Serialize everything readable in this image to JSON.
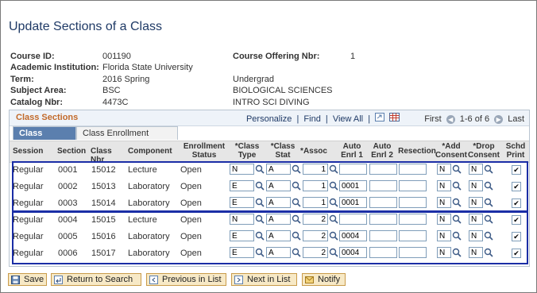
{
  "page_title": "Update Sections of a Class",
  "course_id": {
    "label": "Course ID:",
    "value": "001190"
  },
  "institution": {
    "label": "Academic Institution:",
    "value": "Florida State University"
  },
  "term": {
    "label": "Term:",
    "value": "2016 Spring",
    "career": "Undergrad"
  },
  "subject": {
    "label": "Subject Area:",
    "value": "BSC",
    "desc": "BIOLOGICAL SCIENCES"
  },
  "catalog": {
    "label": "Catalog Nbr:",
    "value": "4473C",
    "desc": "INTRO SCI DIVING"
  },
  "offering": {
    "label": "Course Offering Nbr:",
    "value": "1"
  },
  "grid": {
    "title": "Class Sections",
    "personalize": "Personalize",
    "sep1": "|",
    "find": "Find",
    "sep2": "|",
    "view_all": "View All",
    "sep3": "|",
    "first": "First",
    "range": "1-6 of 6",
    "last": "Last"
  },
  "tabs": [
    {
      "label": "Class Status",
      "active": true
    },
    {
      "label": "Class Enrollment Limits",
      "active": false
    }
  ],
  "headers": {
    "session": "Session",
    "section": "Section",
    "class_nbr": "Class Nbr",
    "component": "Component",
    "enroll_status_1": "Enrollment",
    "enroll_status_2": "Status",
    "class_type_1": "*Class",
    "class_type_2": "Type",
    "class_stat_1": "*Class",
    "class_stat_2": "Stat",
    "assoc": "*Assoc",
    "auto1_1": "Auto",
    "auto1_2": "Enrl 1",
    "auto2_1": "Auto",
    "auto2_2": "Enrl 2",
    "resection": "Resection",
    "add_1": "*Add",
    "add_2": "Consent",
    "drop_1": "*Drop",
    "drop_2": "Consent",
    "schd_1": "Schd",
    "schd_2": "Print"
  },
  "rows": [
    {
      "session": "Regular",
      "section": "0001",
      "class_nbr": "15012",
      "component": "Lecture",
      "status": "Open",
      "class_type": "N",
      "class_stat": "A",
      "assoc": "1",
      "auto1": "",
      "auto2": "",
      "resection": "",
      "add": "N",
      "drop": "N",
      "schd": "✔"
    },
    {
      "session": "Regular",
      "section": "0002",
      "class_nbr": "15013",
      "component": "Laboratory",
      "status": "Open",
      "class_type": "E",
      "class_stat": "A",
      "assoc": "1",
      "auto1": "0001",
      "auto2": "",
      "resection": "",
      "add": "N",
      "drop": "N",
      "schd": "✔"
    },
    {
      "session": "Regular",
      "section": "0003",
      "class_nbr": "15014",
      "component": "Laboratory",
      "status": "Open",
      "class_type": "E",
      "class_stat": "A",
      "assoc": "1",
      "auto1": "0001",
      "auto2": "",
      "resection": "",
      "add": "N",
      "drop": "N",
      "schd": "✔"
    },
    {
      "session": "Regular",
      "section": "0004",
      "class_nbr": "15015",
      "component": "Lecture",
      "status": "Open",
      "class_type": "N",
      "class_stat": "A",
      "assoc": "2",
      "auto1": "",
      "auto2": "",
      "resection": "",
      "add": "N",
      "drop": "N",
      "schd": "✔"
    },
    {
      "session": "Regular",
      "section": "0005",
      "class_nbr": "15016",
      "component": "Laboratory",
      "status": "Open",
      "class_type": "E",
      "class_stat": "A",
      "assoc": "2",
      "auto1": "0004",
      "auto2": "",
      "resection": "",
      "add": "N",
      "drop": "N",
      "schd": "✔"
    },
    {
      "session": "Regular",
      "section": "0006",
      "class_nbr": "15017",
      "component": "Laboratory",
      "status": "Open",
      "class_type": "E",
      "class_stat": "A",
      "assoc": "2",
      "auto1": "0004",
      "auto2": "",
      "resection": "",
      "add": "N",
      "drop": "N",
      "schd": "✔"
    }
  ],
  "buttons": {
    "save": "Save",
    "return": "Return to Search",
    "previous": "Previous in List",
    "next": "Next in List",
    "notify": "Notify"
  },
  "colors": {
    "title": "#1f3a66",
    "grid_title": "#c26a2a",
    "highlight_outline": "#1b2ea6",
    "active_tab": "#5b7fae"
  }
}
